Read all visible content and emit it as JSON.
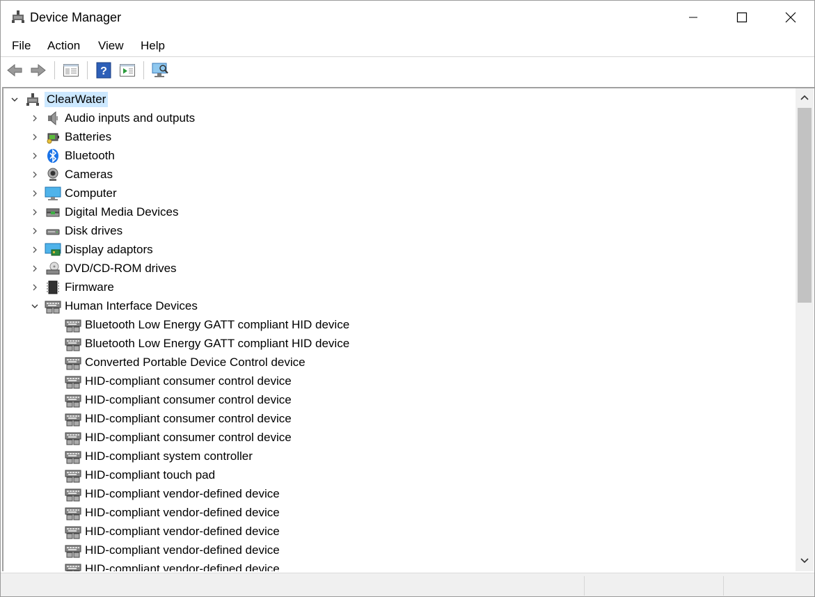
{
  "window": {
    "title": "Device Manager"
  },
  "menu": [
    "File",
    "Action",
    "View",
    "Help"
  ],
  "tree": {
    "root": "ClearWater",
    "categories": [
      {
        "label": "Audio inputs and outputs",
        "icon": "speaker-icon"
      },
      {
        "label": "Batteries",
        "icon": "battery-icon"
      },
      {
        "label": "Bluetooth",
        "icon": "bluetooth-icon"
      },
      {
        "label": "Cameras",
        "icon": "webcam-icon"
      },
      {
        "label": "Computer",
        "icon": "monitor-icon"
      },
      {
        "label": "Digital Media Devices",
        "icon": "media-device-icon"
      },
      {
        "label": "Disk drives",
        "icon": "disk-drive-icon"
      },
      {
        "label": "Display adaptors",
        "icon": "display-adapter-icon"
      },
      {
        "label": "DVD/CD-ROM drives",
        "icon": "dvd-drive-icon"
      },
      {
        "label": "Firmware",
        "icon": "firmware-chip-icon"
      },
      {
        "label": "Human Interface Devices",
        "icon": "hid-icon",
        "expanded": true
      }
    ],
    "hid_children": [
      "Bluetooth Low Energy GATT compliant HID device",
      "Bluetooth Low Energy GATT compliant HID device",
      "Converted Portable Device Control device",
      "HID-compliant consumer control device",
      "HID-compliant consumer control device",
      "HID-compliant consumer control device",
      "HID-compliant consumer control device",
      "HID-compliant system controller",
      "HID-compliant touch pad",
      "HID-compliant vendor-defined device",
      "HID-compliant vendor-defined device",
      "HID-compliant vendor-defined device",
      "HID-compliant vendor-defined device",
      "HID-compliant vendor-defined device"
    ]
  },
  "toolbar": {
    "buttons": [
      "back-arrow-icon",
      "forward-arrow-icon",
      "properties-icon",
      "help-icon",
      "update-driver-icon",
      "scan-hardware-icon"
    ]
  }
}
